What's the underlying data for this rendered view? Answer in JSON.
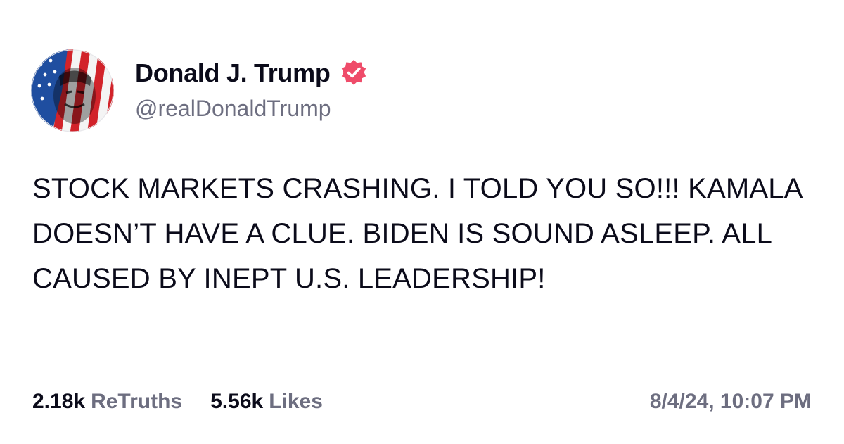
{
  "author": {
    "display_name": "Donald J. Trump",
    "handle": "@realDonaldTrump",
    "verified_icon": "verified-badge-icon",
    "verified_color": "#ef4c6a"
  },
  "post": {
    "text": "STOCK MARKETS CRASHING. I TOLD YOU SO!!! KAMALA DOESN’T HAVE A CLUE. BIDEN IS SOUND ASLEEP. ALL CAUSED BY INEPT U.S. LEADERSHIP!"
  },
  "stats": {
    "retruths_count": "2.18k",
    "retruths_label": "ReTruths",
    "likes_count": "5.56k",
    "likes_label": "Likes"
  },
  "timestamp": "8/4/24, 10:07 PM",
  "colors": {
    "text_primary": "#0b0b1a",
    "text_secondary": "#6d6e80",
    "background": "#ffffff"
  }
}
